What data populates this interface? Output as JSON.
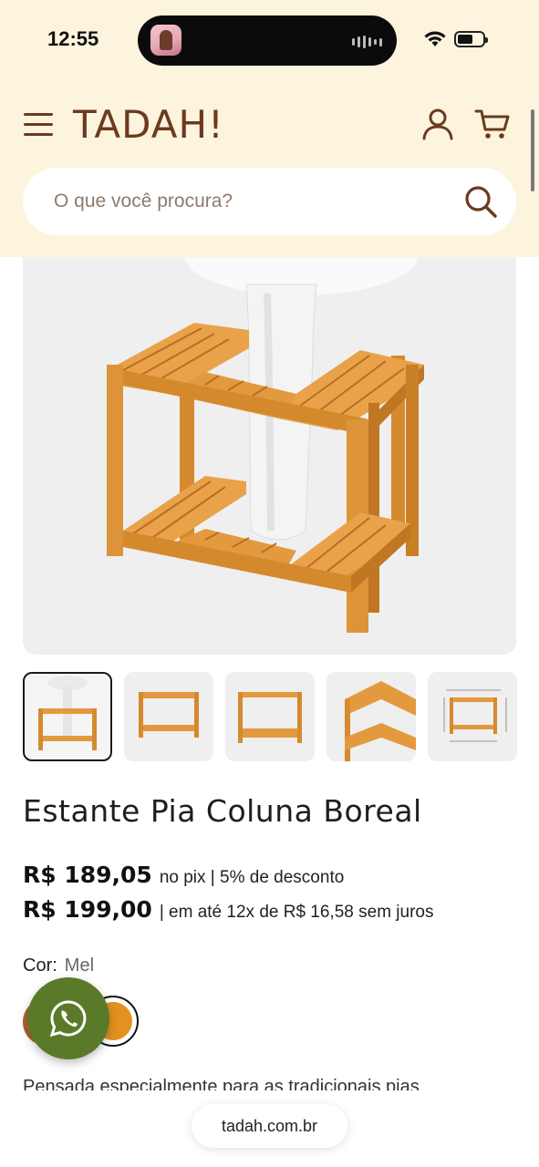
{
  "status_bar": {
    "time": "12:55"
  },
  "header": {
    "logo": "TADAH!",
    "search_placeholder": "O que você procura?"
  },
  "product": {
    "title": "Estante Pia Coluna Boreal",
    "price_pix": "R$ 189,05",
    "price_pix_note": "no pix | 5% de desconto",
    "price_full": "R$ 199,00",
    "price_full_note": "| em até 12x de R$ 16,58 sem juros",
    "color_label": "Cor:",
    "color_value": "Mel",
    "description_start": "Pensada especialmente para as tradicionais pias",
    "swatches": [
      {
        "name": "Castanho",
        "color": "#b0622d"
      },
      {
        "name": "Mel",
        "color": "#e3911f",
        "selected": true
      }
    ],
    "thumbnail_count": 5
  },
  "browser": {
    "url": "tadah.com.br"
  },
  "colors": {
    "header_bg": "#fdf4dd",
    "brand_brown": "#6b3a1f",
    "whatsapp_bg": "#5a7a2a",
    "wood": "#e09a3c"
  },
  "icons": [
    "menu-icon",
    "account-icon",
    "cart-icon",
    "search-icon",
    "whatsapp-icon",
    "wifi-icon",
    "battery-icon"
  ]
}
